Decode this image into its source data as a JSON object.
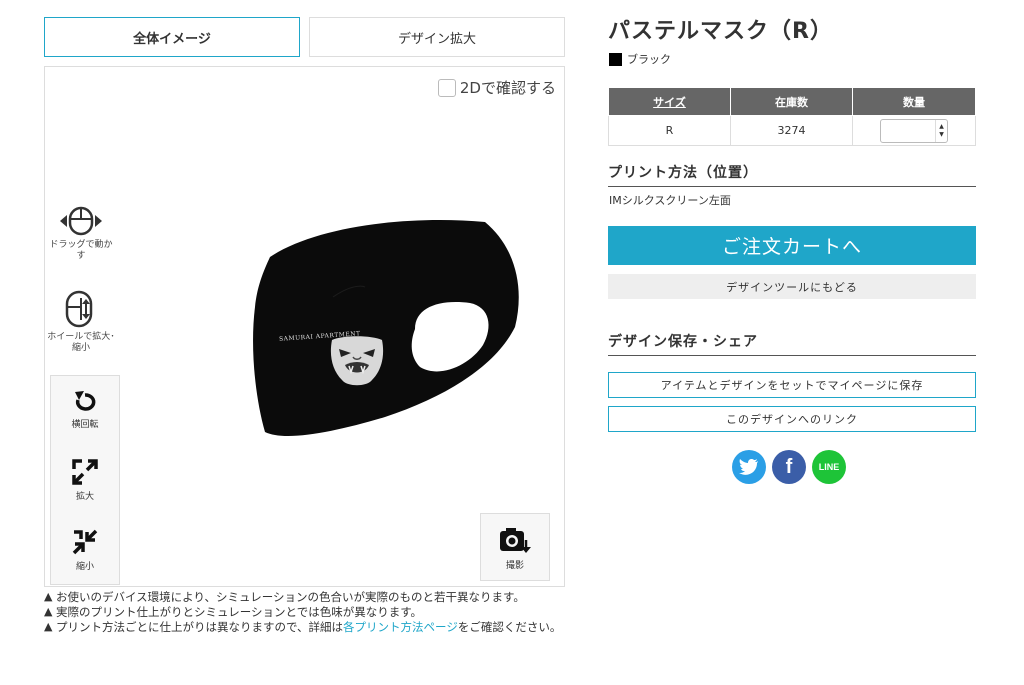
{
  "viewer": {
    "tabs": [
      {
        "label": "全体イメージ"
      },
      {
        "label": "デザイン拡大"
      }
    ],
    "toggle_2d_label": "2Dで確認する",
    "hints": {
      "drag": "ドラッグで動かす",
      "wheel": "ホイールで拡大･縮小"
    },
    "controls": {
      "rotate": "横回転",
      "zoom_in": "拡大",
      "zoom_out": "縮小",
      "screenshot": "撮影"
    },
    "print_text": "SAMURAI APARTMENT"
  },
  "notes": {
    "line1": "お使いのデバイス環境により、シミュレーションの色合いが実際のものと若干異なります。",
    "line2": "実際のプリント仕上がりとシミュレーションとでは色味が異なります。",
    "line3_pre": "プリント方法ごとに仕上がりは異なりますので、詳細は",
    "line3_link": "各プリント方法ページ",
    "line3_post": "をご確認ください。"
  },
  "product": {
    "title": "パステルマスク（R）",
    "color_name": "ブラック",
    "color_hex": "#000000"
  },
  "stock_table": {
    "headers": {
      "size": "サイズ",
      "stock": "在庫数",
      "qty": "数量"
    },
    "rows": [
      {
        "size": "R",
        "stock": "3274",
        "qty": ""
      }
    ]
  },
  "print": {
    "heading": "プリント方法（位置）",
    "method": "IMシルクスクリーン左面"
  },
  "buttons": {
    "cart": "ご注文カートへ",
    "back_to_tool": "デザインツールにもどる"
  },
  "save_share": {
    "heading": "デザイン保存・シェア",
    "save_mypage": "アイテムとデザインをセットでマイページに保存",
    "design_link": "このデザインへのリンク"
  },
  "share": {
    "facebook_glyph": "f",
    "line_label": "LINE"
  },
  "colors": {
    "accent": "#1fa6c9",
    "table_header": "#666666",
    "twitter": "#2b9fe6",
    "facebook": "#3b5ea8",
    "line": "#1ec438"
  }
}
